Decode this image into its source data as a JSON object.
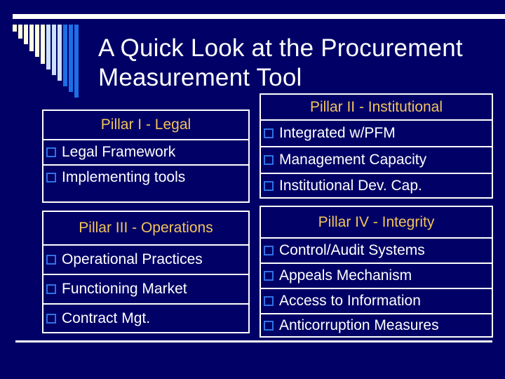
{
  "slide": {
    "title_line1": "A Quick Look at the Procurement",
    "title_line2": "Measurement Tool",
    "colors": {
      "background": "#000066",
      "heading": "#f2c45c",
      "text": "#ffffff",
      "bullet": "#2f72e6",
      "bar_cream": "#fffde0",
      "bar_light_blue": "#cce0ff",
      "bar_bright_blue": "#1e6ee6"
    }
  },
  "pillars": [
    {
      "heading": "Pillar I - Legal",
      "items": [
        "Legal Framework",
        "Implementing tools"
      ]
    },
    {
      "heading": "Pillar II - Institutional",
      "items": [
        "Integrated w/PFM",
        "Management Capacity",
        "Institutional Dev. Cap."
      ]
    },
    {
      "heading": "Pillar III - Operations",
      "items": [
        "Operational Practices",
        "Functioning Market",
        "Contract Mgt."
      ]
    },
    {
      "heading": "Pillar IV - Integrity",
      "items": [
        "Control/Audit Systems",
        "Appeals Mechanism",
        "Access to Information",
        "Anticorruption Measures"
      ]
    }
  ]
}
